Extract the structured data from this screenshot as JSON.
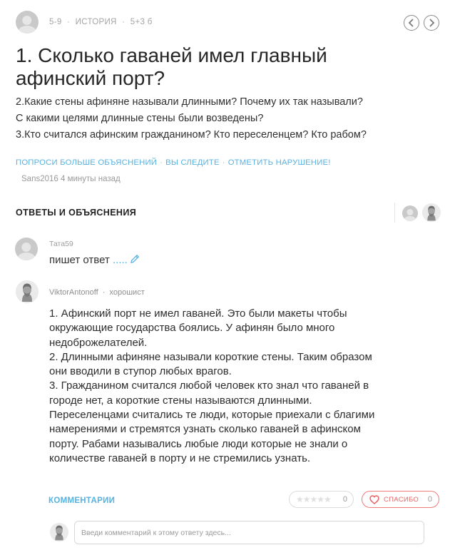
{
  "question": {
    "meta": {
      "grade": "5-9",
      "subject": "ИСТОРИЯ",
      "points": "5+3 б",
      "separator": "·"
    },
    "title": "1. Сколько гаваней имел главный афинский порт?",
    "body_lines": [
      "2.Какие стены афиняне называли длинными? Почему их так называли?",
      "С какими целями длинные стены были возведены?",
      "3.Кто считался афинским гражданином? Кто переселенцем? Кто рабом?"
    ],
    "actions": {
      "ask_more": "ПОПРОСИ БОЛЬШЕ ОБЪЯСНЕНИЙ",
      "following": "ВЫ СЛЕДИТЕ",
      "report": "ОТМЕТИТЬ НАРУШЕНИЕ!",
      "separator": "·"
    },
    "author": "Sans2016",
    "time_ago": "4 минуты назад"
  },
  "answers_section": {
    "header": "ОТВЕТЫ И ОБЪЯСНЕНИЯ"
  },
  "draft": {
    "username": "Тата59",
    "status_text": "пишет ответ",
    "dots": "....."
  },
  "answer": {
    "username": "ViktorAntonoff",
    "rank": "хорошист",
    "separator": "·",
    "lines": [
      "1. Афинский порт не имел гаваней. Это были макеты чтобы",
      "окружающие государства боялись. У афинян было много",
      "недоброжелателей.",
      "2. Длинными афиняне называли короткие стены. Таким образом",
      "они вводили в ступор любых врагов.",
      "3. Гражданином считался любой человек кто знал что гаваней в",
      "городе нет, а короткие стены называются длинными.",
      "Переселенцами считались те люди, которые приехали с благими",
      "намерениями и стремятся узнать сколько гаваней в афинском",
      "порту. Рабами назывались любые люди которые не знали о",
      "количестве гаваней в порту и не стремились узнать."
    ],
    "comments_label": "КОММЕНТАРИИ",
    "rating_stars": "★★★★★",
    "rating_count": "0",
    "thanks_label": "СПАСИБО",
    "thanks_count": "0",
    "comment_placeholder": "Введи комментарий к этому ответу здесь..."
  },
  "colors": {
    "link": "#57b2e0",
    "thanks": "#e86464",
    "muted": "#a4a4a4"
  },
  "icons": {
    "prev": "chevron-left-icon",
    "next": "chevron-right-icon",
    "pencil": "pencil-icon",
    "heart": "heart-icon",
    "star": "star-icon"
  }
}
